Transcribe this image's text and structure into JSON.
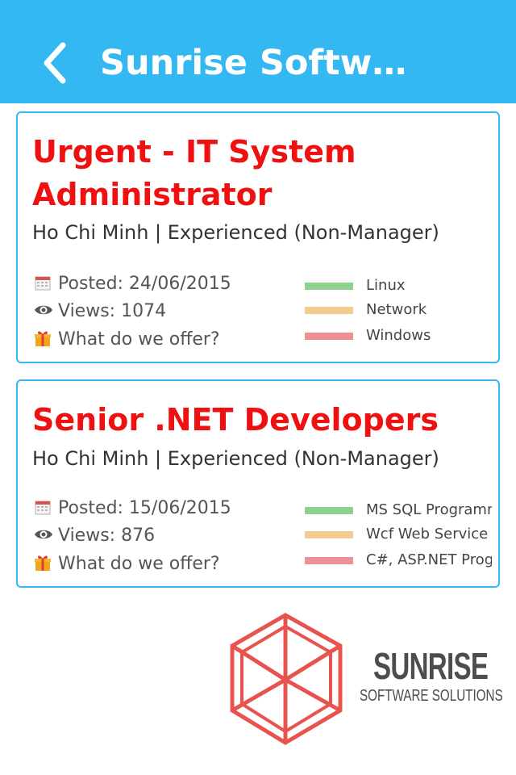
{
  "header": {
    "title": "Sunrise Softwar…",
    "background": "#33b8f2",
    "back_icon": "chevron-left-icon"
  },
  "jobs": [
    {
      "title": "Urgent - IT System Administrator",
      "subtitle": "Ho Chi Minh | Experienced (Non-Manager)",
      "posted": "Posted: 24/06/2015",
      "views": "Views: 1074",
      "offer": "What do we offer?",
      "tags": [
        {
          "label": "Linux",
          "color": "#8fd18f"
        },
        {
          "label": "Network",
          "color": "#f1cb8f"
        },
        {
          "label": "Windows",
          "color": "#ee8f95"
        }
      ]
    },
    {
      "title": "Senior .NET Developers",
      "subtitle": "Ho Chi Minh | Experienced (Non-Manager)",
      "posted": "Posted: 15/06/2015",
      "views": "Views: 876",
      "offer": "What do we offer?",
      "tags": [
        {
          "label": "MS SQL Programming",
          "color": "#8fd18f"
        },
        {
          "label": "Wcf Web Service",
          "color": "#f1cb8f"
        },
        {
          "label": "C#, ASP.NET Programming",
          "color": "#ee8f95"
        }
      ]
    }
  ],
  "icons": {
    "posted": "calendar-icon",
    "views": "eye-icon",
    "offer": "gift-icon"
  },
  "logo": {
    "name": "SUNRISE",
    "tagline": "SOFTWARE SOLUTIONS",
    "color": "#e8544d"
  },
  "colors": {
    "accent": "#33b8f2",
    "job_title": "#ef1111"
  }
}
